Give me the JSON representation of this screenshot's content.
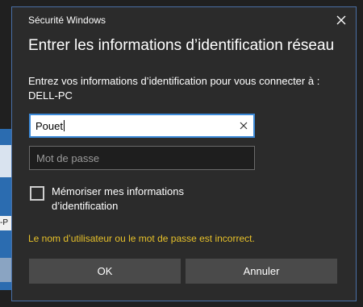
{
  "window": {
    "app_title": "Sécurité Windows",
    "heading": "Entrer les informations d’identification réseau",
    "close_icon": "close-icon"
  },
  "prompt": {
    "line1": "Entrez vos informations d’identification pour vous connecter à :",
    "line2": "DELL-PC"
  },
  "username": {
    "value": "Pouet",
    "clear_icon": "clear-icon"
  },
  "password": {
    "value": "",
    "placeholder": "Mot de passe"
  },
  "remember": {
    "label": "Mémoriser mes informations d’identification",
    "checked": false
  },
  "error_message": "Le nom d’utilisateur ou le mot de passe est incorrect.",
  "buttons": {
    "ok": "OK",
    "cancel": "Annuler"
  },
  "background_window": {
    "fragment": "-P"
  },
  "colors": {
    "dialog_bg": "#2b2b2b",
    "accent": "#3c8ad8",
    "error": "#e6c02a",
    "button_bg": "#4a4a4a"
  }
}
